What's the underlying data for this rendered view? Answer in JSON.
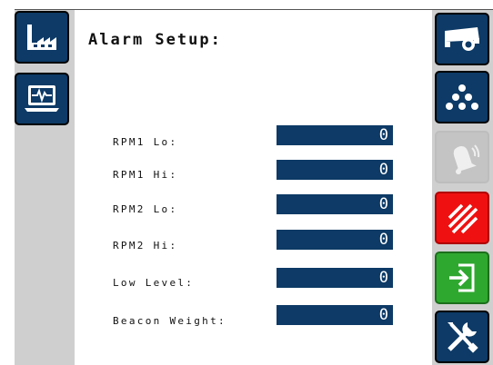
{
  "page": {
    "title": "Alarm Setup:"
  },
  "fields": [
    {
      "label": "RPM1 Lo:",
      "value": "0"
    },
    {
      "label": "RPM1 Hi:",
      "value": "0"
    },
    {
      "label": "RPM2 Lo:",
      "value": "0"
    },
    {
      "label": "RPM2 Hi:",
      "value": "0"
    },
    {
      "label": "Low Level:",
      "value": "0"
    },
    {
      "label": "Beacon Weight:",
      "value": "0"
    }
  ],
  "left_nav": [
    {
      "icon": "factory-icon",
      "color": "#0d3a66"
    },
    {
      "icon": "monitor-diagnostics-icon",
      "color": "#0d3a66"
    }
  ],
  "right_nav": [
    {
      "icon": "spreader-truck-icon",
      "color": "#0d3a66"
    },
    {
      "icon": "seed-pile-icon",
      "color": "#0d3a66"
    },
    {
      "icon": "alarm-bell-icon",
      "color": "#c4c4c4",
      "state": "disabled"
    },
    {
      "icon": "cancel-hatch-icon",
      "color": "#ef1111"
    },
    {
      "icon": "enter-arrow-icon",
      "color": "#2fa82f"
    },
    {
      "icon": "tools-icon",
      "color": "#0d3a66"
    }
  ]
}
